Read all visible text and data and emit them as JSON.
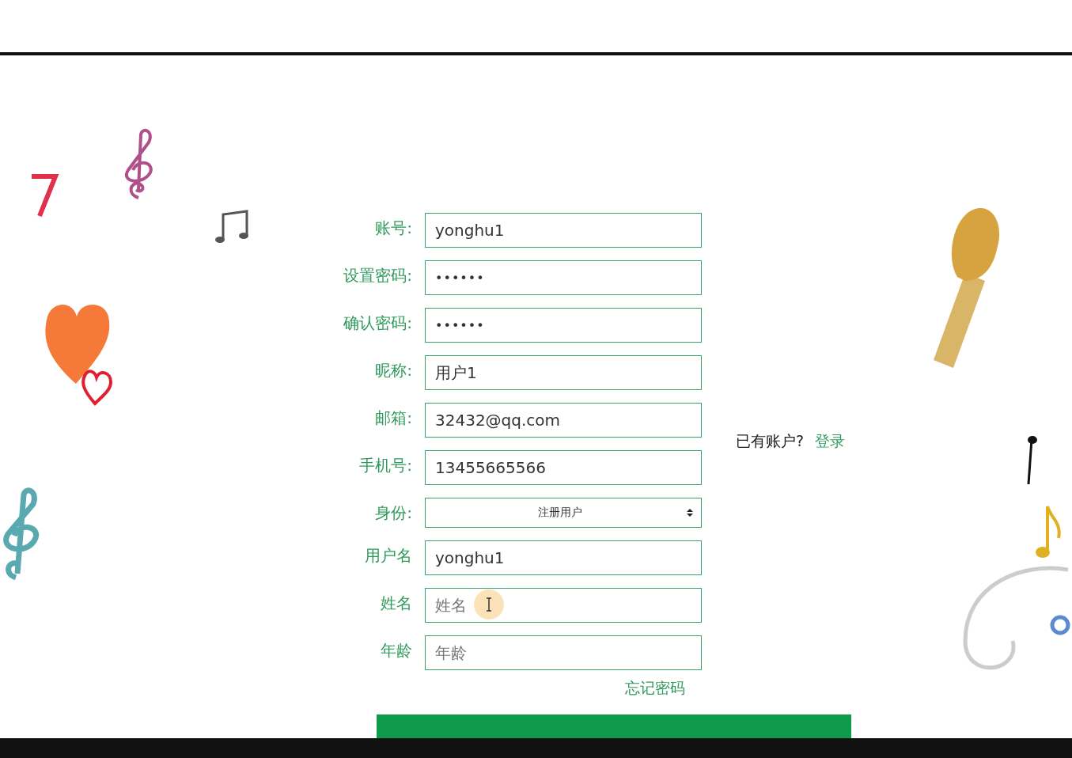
{
  "form": {
    "fields": [
      {
        "label": "账号:",
        "kind": "text",
        "value": "yonghu1"
      },
      {
        "label": "设置密码:",
        "kind": "password",
        "value": "••••••"
      },
      {
        "label": "确认密码:",
        "kind": "password",
        "value": "••••••"
      },
      {
        "label": "昵称:",
        "kind": "text",
        "value": "用户1"
      },
      {
        "label": "邮箱:",
        "kind": "text",
        "value": "32432@qq.com"
      },
      {
        "label": "手机号:",
        "kind": "text",
        "value": "13455665566"
      },
      {
        "label": "身份:",
        "kind": "select",
        "value": "注册用户"
      },
      {
        "label": "用户名",
        "kind": "text",
        "value": "yonghu1"
      },
      {
        "label": "姓名",
        "kind": "text",
        "placeholder": "姓名",
        "focused": true
      },
      {
        "label": "年龄",
        "kind": "text",
        "placeholder": "年龄"
      }
    ],
    "forgot_link": "忘记密码"
  },
  "login_prompt": {
    "text": "已有账户?",
    "link": "登录"
  }
}
